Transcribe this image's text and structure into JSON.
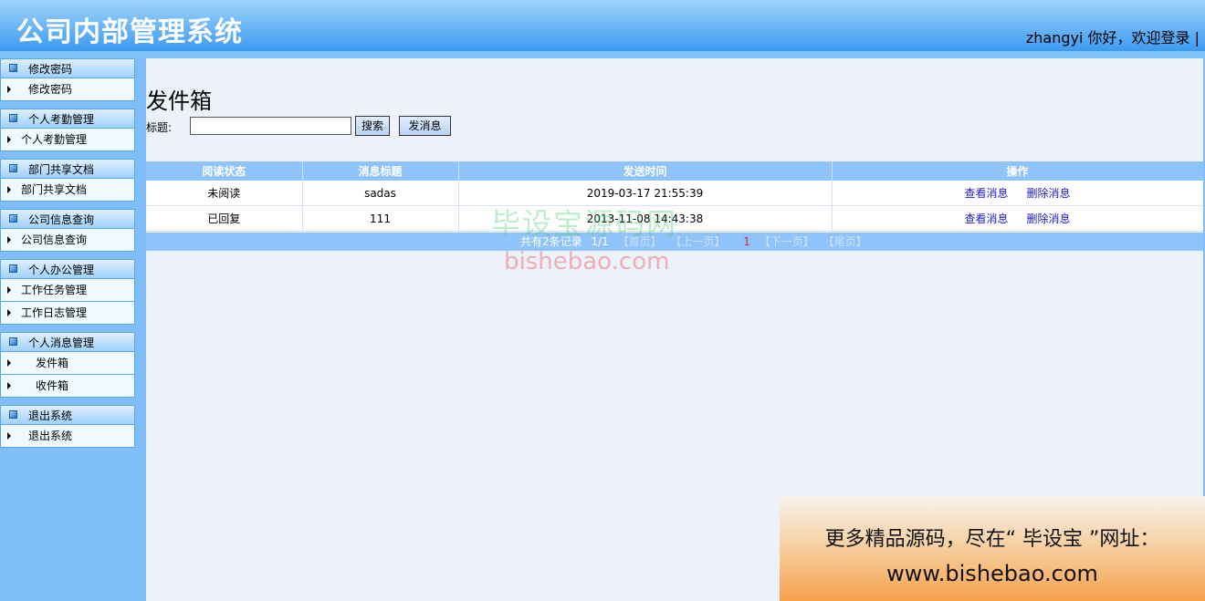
{
  "header": {
    "app_title": "公司内部管理系统",
    "greeting": "zhangyi 你好，欢迎登录 |"
  },
  "sidebar": {
    "groups": [
      {
        "title": "修改密码",
        "items": [
          "修改密码"
        ]
      },
      {
        "title": "个人考勤管理",
        "items": [
          "个人考勤管理"
        ]
      },
      {
        "title": "部门共享文档",
        "items": [
          "部门共享文档"
        ]
      },
      {
        "title": "公司信息查询",
        "items": [
          "公司信息查询"
        ]
      },
      {
        "title": "个人办公管理",
        "items": [
          "工作任务管理",
          "工作日志管理"
        ]
      },
      {
        "title": "个人消息管理",
        "items": [
          "发件箱",
          "收件箱"
        ]
      },
      {
        "title": "退出系统",
        "items": [
          "退出系统"
        ]
      }
    ]
  },
  "main": {
    "page_title": "发件箱",
    "search": {
      "label": "标题:",
      "value": "",
      "button": "搜索"
    },
    "send_button": "发消息",
    "table": {
      "headers": [
        "阅读状态",
        "消息标题",
        "发送时间",
        "操作"
      ],
      "rows": [
        {
          "status": "未阅读",
          "title": "sadas",
          "time": "2019-03-17 21:55:39",
          "view": "查看消息",
          "delete": "删除消息"
        },
        {
          "status": "已回复",
          "title": "111",
          "time": "2013-11-08 14:43:38",
          "view": "查看消息",
          "delete": "删除消息"
        }
      ]
    },
    "pager": {
      "summary": "共有2条记录",
      "page_info": "1/1",
      "first": "【首页】",
      "prev": "【上一页】",
      "current": "1",
      "next": "【下一页】",
      "last": "【尾页】"
    }
  },
  "watermark": {
    "cn": "毕设宝源码网",
    "en": "bishebao.com"
  },
  "ad": {
    "line1": "更多精品源码，尽在“ 毕设宝 ”网址：",
    "line2": "www.bishebao.com"
  },
  "colors": {
    "header_top": "#9fd4fb",
    "header_bottom": "#3d9af0",
    "sidebar_bg": "#7fbef8",
    "main_bg": "#edf1fa",
    "table_header": "#8fc4fb",
    "link": "#1c1cd0",
    "pager_current": "#e0242c"
  }
}
